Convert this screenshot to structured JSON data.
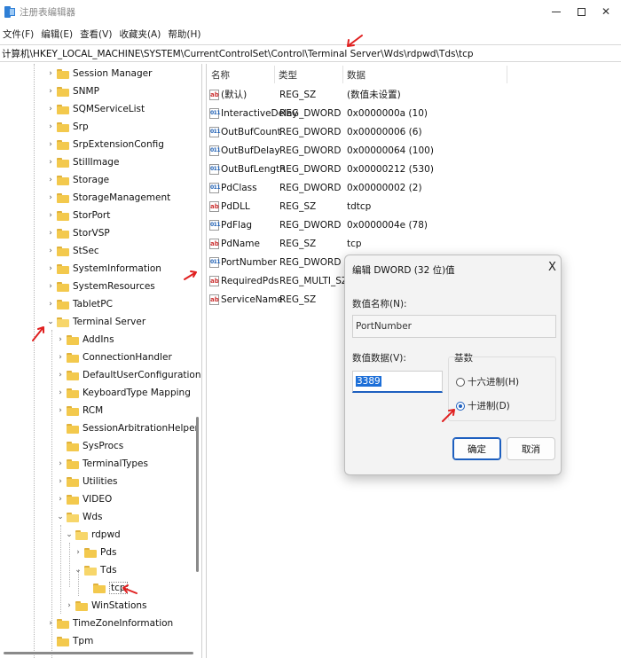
{
  "window": {
    "title": "注册表编辑器",
    "controls": {
      "minimize": "—",
      "maximize": "□",
      "close": "✕"
    }
  },
  "menu": [
    "文件(F)",
    "编辑(E)",
    "查看(V)",
    "收藏夹(A)",
    "帮助(H)"
  ],
  "address": "计算机\\HKEY_LOCAL_MACHINE\\SYSTEM\\CurrentControlSet\\Control\\Terminal Server\\Wds\\rdpwd\\Tds\\tcp",
  "tree": [
    {
      "label": "Session Manager",
      "chevron": "›"
    },
    {
      "label": "SNMP",
      "chevron": "›"
    },
    {
      "label": "SQMServiceList",
      "chevron": "›"
    },
    {
      "label": "Srp",
      "chevron": "›"
    },
    {
      "label": "SrpExtensionConfig",
      "chevron": "›"
    },
    {
      "label": "StillImage",
      "chevron": "›"
    },
    {
      "label": "Storage",
      "chevron": "›"
    },
    {
      "label": "StorageManagement",
      "chevron": "›"
    },
    {
      "label": "StorPort",
      "chevron": "›"
    },
    {
      "label": "StorVSP",
      "chevron": "›"
    },
    {
      "label": "StSec",
      "chevron": "›"
    },
    {
      "label": "SystemInformation",
      "chevron": "›"
    },
    {
      "label": "SystemResources",
      "chevron": "›"
    },
    {
      "label": "TabletPC",
      "chevron": "›"
    },
    {
      "label": "Terminal Server",
      "chevron": "⌄"
    },
    {
      "label": "AddIns",
      "chevron": "›"
    },
    {
      "label": "ConnectionHandler",
      "chevron": "›"
    },
    {
      "label": "DefaultUserConfiguration",
      "chevron": "›"
    },
    {
      "label": "KeyboardType Mapping",
      "chevron": "›"
    },
    {
      "label": "RCM",
      "chevron": "›"
    },
    {
      "label": "SessionArbitrationHelper",
      "chevron": ""
    },
    {
      "label": "SysProcs",
      "chevron": ""
    },
    {
      "label": "TerminalTypes",
      "chevron": "›"
    },
    {
      "label": "Utilities",
      "chevron": "›"
    },
    {
      "label": "VIDEO",
      "chevron": "›"
    },
    {
      "label": "Wds",
      "chevron": "⌄"
    },
    {
      "label": "rdpwd",
      "chevron": "⌄"
    },
    {
      "label": "Pds",
      "chevron": "›"
    },
    {
      "label": "Tds",
      "chevron": "⌄"
    },
    {
      "label": "tcp",
      "chevron": ""
    },
    {
      "label": "WinStations",
      "chevron": "›"
    },
    {
      "label": "TimeZoneInformation",
      "chevron": "›"
    },
    {
      "label": "Tpm",
      "chevron": ""
    }
  ],
  "list": {
    "headers": {
      "name": "名称",
      "type": "类型",
      "data": "数据"
    },
    "rows": [
      {
        "icon": "ab",
        "name": "(默认)",
        "type": "REG_SZ",
        "data": "(数值未设置)"
      },
      {
        "icon": "bin",
        "name": "InteractiveDelay",
        "type": "REG_DWORD",
        "data": "0x0000000a (10)"
      },
      {
        "icon": "bin",
        "name": "OutBufCount",
        "type": "REG_DWORD",
        "data": "0x00000006 (6)"
      },
      {
        "icon": "bin",
        "name": "OutBufDelay",
        "type": "REG_DWORD",
        "data": "0x00000064 (100)"
      },
      {
        "icon": "bin",
        "name": "OutBufLength",
        "type": "REG_DWORD",
        "data": "0x00000212 (530)"
      },
      {
        "icon": "bin",
        "name": "PdClass",
        "type": "REG_DWORD",
        "data": "0x00000002 (2)"
      },
      {
        "icon": "ab",
        "name": "PdDLL",
        "type": "REG_SZ",
        "data": "tdtcp"
      },
      {
        "icon": "bin",
        "name": "PdFlag",
        "type": "REG_DWORD",
        "data": "0x0000004e (78)"
      },
      {
        "icon": "ab",
        "name": "PdName",
        "type": "REG_SZ",
        "data": "tcp"
      },
      {
        "icon": "bin",
        "name": "PortNumber",
        "type": "REG_DWORD",
        "data": ""
      },
      {
        "icon": "ab",
        "name": "RequiredPds",
        "type": "REG_MULTI_SZ",
        "data": ""
      },
      {
        "icon": "ab",
        "name": "ServiceName",
        "type": "REG_SZ",
        "data": ""
      }
    ]
  },
  "dialog": {
    "title": "编辑 DWORD (32 位)值",
    "close": "X",
    "name_label": "数值名称(N):",
    "name_value": "PortNumber",
    "data_label": "数值数据(V):",
    "data_value": "3389",
    "base_label": "基数",
    "radio_hex": "十六进制(H)",
    "radio_dec": "十进制(D)",
    "selected_base": "decimal",
    "ok": "确定",
    "cancel": "取消"
  },
  "annotation_color": "#e02020"
}
